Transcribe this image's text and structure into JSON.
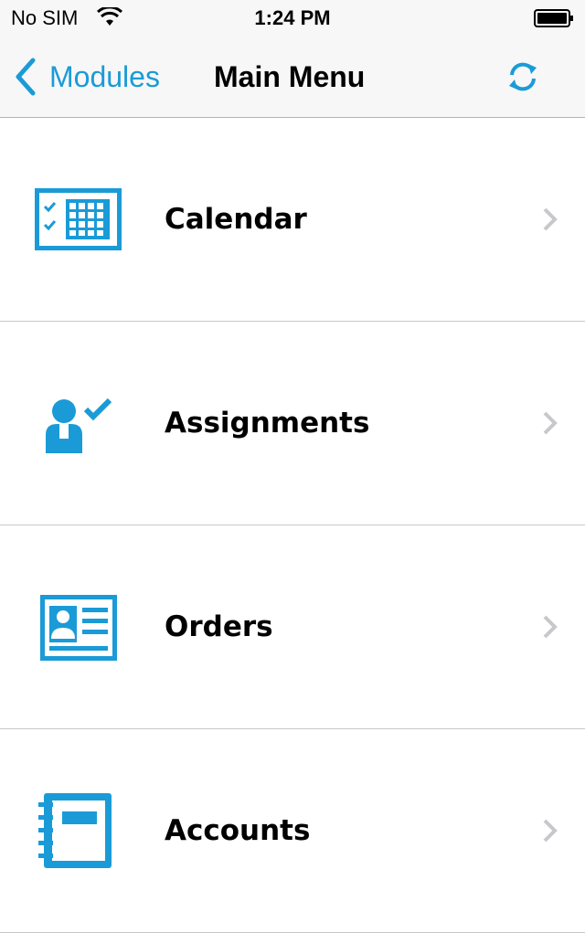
{
  "status_bar": {
    "carrier": "No SIM",
    "time": "1:24 PM"
  },
  "nav": {
    "back_label": "Modules",
    "title": "Main Menu"
  },
  "accent_color": "#1a9bd7",
  "menu": {
    "items": [
      {
        "label": "Calendar",
        "icon": "calendar-icon"
      },
      {
        "label": "Assignments",
        "icon": "person-check-icon"
      },
      {
        "label": "Orders",
        "icon": "id-card-icon"
      },
      {
        "label": "Accounts",
        "icon": "address-book-icon"
      }
    ]
  }
}
